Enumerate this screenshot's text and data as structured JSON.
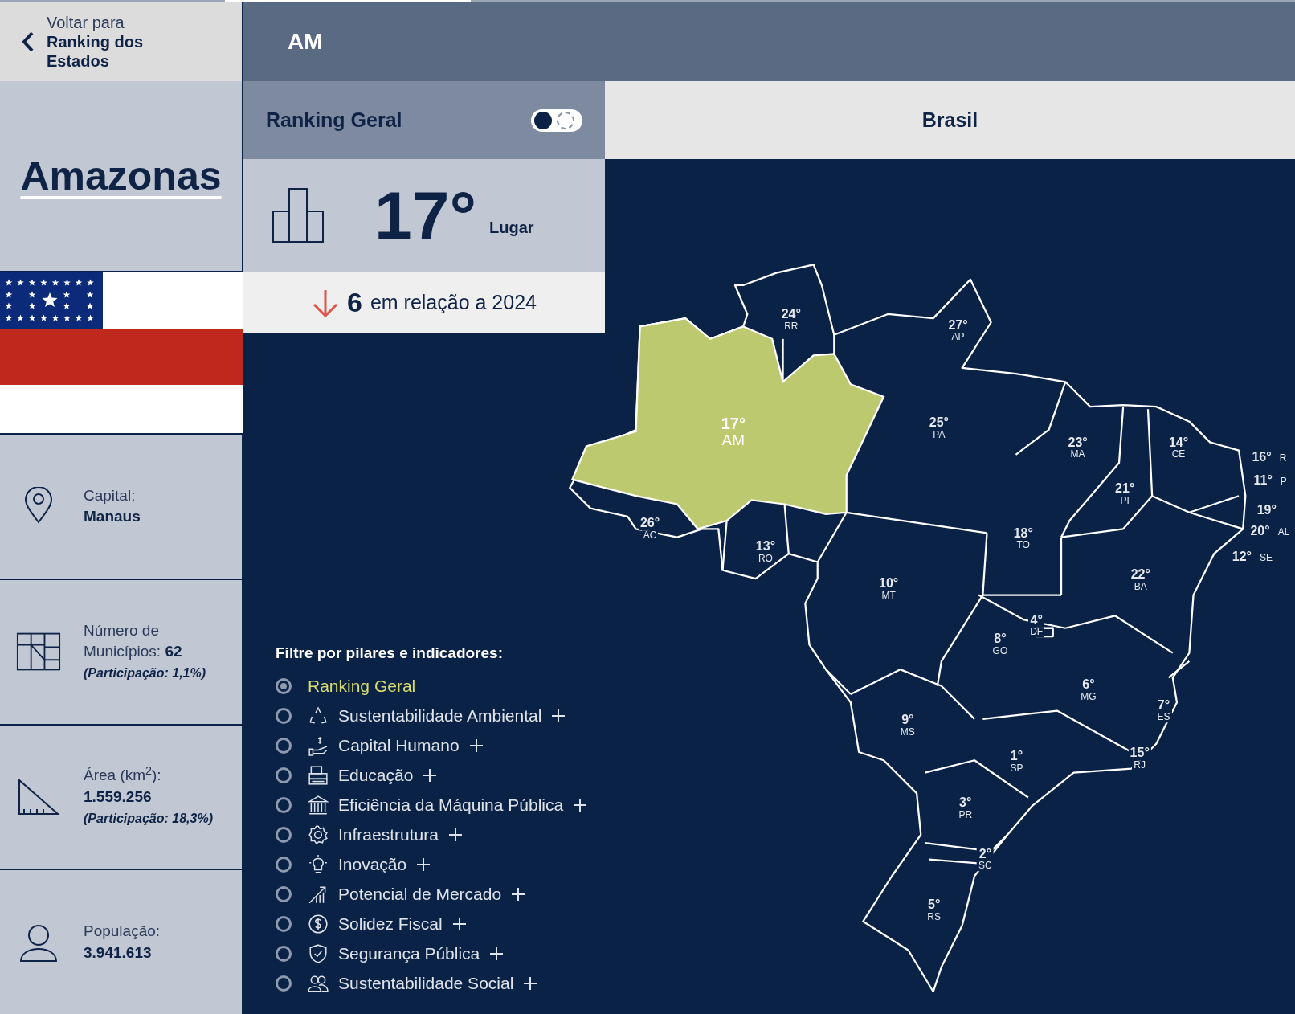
{
  "back_link": {
    "caption": "Voltar para",
    "target": "Ranking dos Estados"
  },
  "header": {
    "state_code": "AM"
  },
  "state": {
    "name": "Amazonas"
  },
  "info": [
    {
      "kind": "capital",
      "label": "Capital:",
      "value": "Manaus"
    },
    {
      "kind": "municipalities",
      "label": "Número de Municípios: **62**",
      "note": "(Participação: 1,1%)"
    },
    {
      "kind": "area",
      "label": "Área (km$^{2}$):",
      "value": "1.559.256",
      "note": "(Participação: 18,3%)"
    },
    {
      "kind": "population",
      "label": "População:",
      "value": "3.941.613"
    }
  ],
  "ranking_card": {
    "title": "Ranking Geral",
    "toggle": {
      "on": false
    },
    "position": "17°",
    "position_label": "Lugar",
    "change": {
      "falling": true,
      "amount": "6",
      "text": "em relação a 2024"
    }
  },
  "scope_tab": {
    "label": "Brasil"
  },
  "filter": {
    "title": "Filtre por pilares e indicadores:",
    "items": [
      {
        "label": "Ranking Geral",
        "selected": true,
        "expandable": false
      },
      {
        "label": "Sustentabilidade Ambiental",
        "selected": false,
        "expandable": true
      },
      {
        "label": "Capital Humano",
        "selected": false,
        "expandable": true
      },
      {
        "label": "Educação",
        "selected": false,
        "expandable": true
      },
      {
        "label": "Eficiência da Máquina Pública",
        "selected": false,
        "expandable": true
      },
      {
        "label": "Infraestrutura",
        "selected": false,
        "expandable": true
      },
      {
        "label": "Inovação",
        "selected": false,
        "expandable": true
      },
      {
        "label": "Potencial de Mercado",
        "selected": false,
        "expandable": true
      },
      {
        "label": "Solidez Fiscal",
        "selected": false,
        "expandable": true
      },
      {
        "label": "Segurança Pública",
        "selected": false,
        "expandable": true
      },
      {
        "label": "Sustentabilidade Social",
        "selected": false,
        "expandable": true
      }
    ]
  },
  "map": {
    "states": [
      {
        "rank": "24°",
        "code": "RR",
        "kind": "stacked",
        "highlighted": false
      },
      {
        "rank": "27°",
        "code": "AP",
        "kind": "stacked",
        "highlighted": false
      },
      {
        "rank": "17°",
        "code": "AM",
        "kind": "stacked",
        "highlighted": true
      },
      {
        "rank": "25°",
        "code": "PA",
        "kind": "stacked",
        "highlighted": false
      },
      {
        "rank": "23°",
        "code": "MA",
        "kind": "stacked",
        "highlighted": false
      },
      {
        "rank": "14°",
        "code": "CE",
        "kind": "stacked",
        "highlighted": false
      },
      {
        "rank": "16°",
        "code": "R",
        "kind": "inline",
        "highlighted": false
      },
      {
        "rank": "11°",
        "code": "P",
        "kind": "inline",
        "highlighted": false
      },
      {
        "rank": "21°",
        "code": "PI",
        "kind": "stacked",
        "highlighted": false
      },
      {
        "rank": "19°",
        "kind": "inline",
        "highlighted": false
      },
      {
        "rank": "26°",
        "code": "AC",
        "kind": "stacked",
        "highlighted": false
      },
      {
        "rank": "13°",
        "code": "RO",
        "kind": "stacked",
        "highlighted": false
      },
      {
        "rank": "18°",
        "code": "TO",
        "kind": "stacked",
        "highlighted": false
      },
      {
        "rank": "20°",
        "code": "AL",
        "kind": "inline",
        "highlighted": false
      },
      {
        "rank": "12°",
        "code": "SE",
        "kind": "inline",
        "highlighted": false
      },
      {
        "rank": "22°",
        "code": "BA",
        "kind": "stacked",
        "highlighted": false
      },
      {
        "rank": "10°",
        "code": "MT",
        "kind": "stacked",
        "highlighted": false
      },
      {
        "rank": "4°",
        "code": "DF",
        "kind": "stacked",
        "highlighted": false
      },
      {
        "rank": "8°",
        "code": "GO",
        "kind": "stacked",
        "highlighted": false
      },
      {
        "rank": "6°",
        "code": "MG",
        "kind": "stacked",
        "highlighted": false
      },
      {
        "rank": "7°",
        "code": "ES",
        "kind": "stacked",
        "highlighted": false
      },
      {
        "rank": "9°",
        "code": "MS",
        "kind": "stacked",
        "highlighted": false
      },
      {
        "rank": "15°",
        "code": "RJ",
        "kind": "stacked",
        "highlighted": false
      },
      {
        "rank": "1°",
        "code": "SP",
        "kind": "stacked",
        "highlighted": false
      },
      {
        "rank": "3°",
        "code": "PR",
        "kind": "stacked",
        "highlighted": false
      },
      {
        "rank": "2°",
        "code": "SC",
        "kind": "stacked",
        "highlighted": false
      },
      {
        "rank": "5°",
        "code": "RS",
        "kind": "stacked",
        "highlighted": false
      }
    ]
  }
}
